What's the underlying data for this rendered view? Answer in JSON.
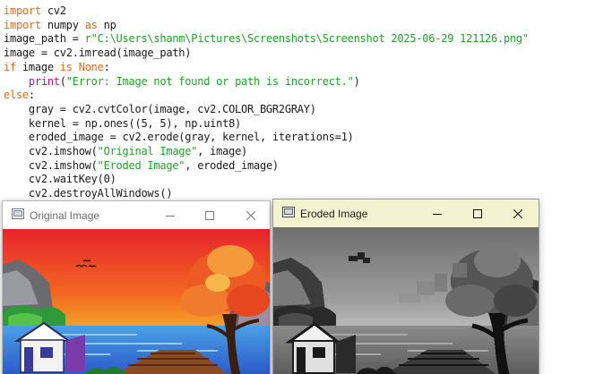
{
  "code": {
    "lines": [
      {
        "tokens": [
          {
            "t": "import",
            "c": "kw"
          },
          {
            "t": " cv2",
            "c": ""
          }
        ]
      },
      {
        "tokens": [
          {
            "t": "import",
            "c": "kw"
          },
          {
            "t": " numpy ",
            "c": ""
          },
          {
            "t": "as",
            "c": "kw"
          },
          {
            "t": " np",
            "c": ""
          }
        ]
      },
      {
        "tokens": [
          {
            "t": "image_path = ",
            "c": ""
          },
          {
            "t": "r\"C:\\Users\\shanm\\Pictures\\Screenshots\\Screenshot 2025-06-29 121126.png\"",
            "c": "str"
          }
        ]
      },
      {
        "tokens": [
          {
            "t": "image = cv2.imread(image_path)",
            "c": ""
          }
        ]
      },
      {
        "tokens": [
          {
            "t": "if",
            "c": "kw"
          },
          {
            "t": " image ",
            "c": ""
          },
          {
            "t": "is",
            "c": "kw"
          },
          {
            "t": " ",
            "c": ""
          },
          {
            "t": "None",
            "c": "kw"
          },
          {
            "t": ":",
            "c": ""
          }
        ]
      },
      {
        "tokens": [
          {
            "t": "    ",
            "c": ""
          },
          {
            "t": "print",
            "c": "kw2"
          },
          {
            "t": "(",
            "c": ""
          },
          {
            "t": "\"Error: Image not found or path is incorrect.\"",
            "c": "str"
          },
          {
            "t": ")",
            "c": ""
          }
        ]
      },
      {
        "tokens": [
          {
            "t": "else",
            "c": "kw"
          },
          {
            "t": ":",
            "c": ""
          }
        ]
      },
      {
        "tokens": [
          {
            "t": "    gray = cv2.cvtColor(image, cv2.COLOR_BGR2GRAY)",
            "c": ""
          }
        ]
      },
      {
        "tokens": [
          {
            "t": "    kernel = np.ones((5, 5), np.uint8)",
            "c": ""
          }
        ]
      },
      {
        "tokens": [
          {
            "t": "    eroded_image = cv2.erode(gray, kernel, iterations=1)",
            "c": ""
          }
        ]
      },
      {
        "tokens": [
          {
            "t": "    cv2.imshow(",
            "c": ""
          },
          {
            "t": "\"Original Image\"",
            "c": "str"
          },
          {
            "t": ", image)",
            "c": ""
          }
        ]
      },
      {
        "tokens": [
          {
            "t": "    cv2.imshow(",
            "c": ""
          },
          {
            "t": "\"Eroded Image\"",
            "c": "str"
          },
          {
            "t": ", eroded_image)",
            "c": ""
          }
        ]
      },
      {
        "tokens": [
          {
            "t": "    cv2.waitKey(0)",
            "c": ""
          }
        ]
      },
      {
        "tokens": [
          {
            "t": "    cv2.destroyAllWindows()",
            "c": ""
          }
        ]
      }
    ]
  },
  "windows": {
    "original": {
      "title": "Original Image",
      "icons": {
        "app": "image-window-icon",
        "minimize": "minimize-icon",
        "maximize": "maximize-icon",
        "close": "close-icon"
      },
      "titlebar_color": "#ffffff"
    },
    "eroded": {
      "title": "Eroded Image",
      "icons": {
        "app": "image-window-icon",
        "minimize": "minimize-icon",
        "maximize": "maximize-icon",
        "close": "close-icon"
      },
      "titlebar_color": "#f3f3d2"
    }
  },
  "colors": {
    "keyword": "#e26a1c",
    "builtin": "#b01a7a",
    "string": "#22a12a"
  }
}
